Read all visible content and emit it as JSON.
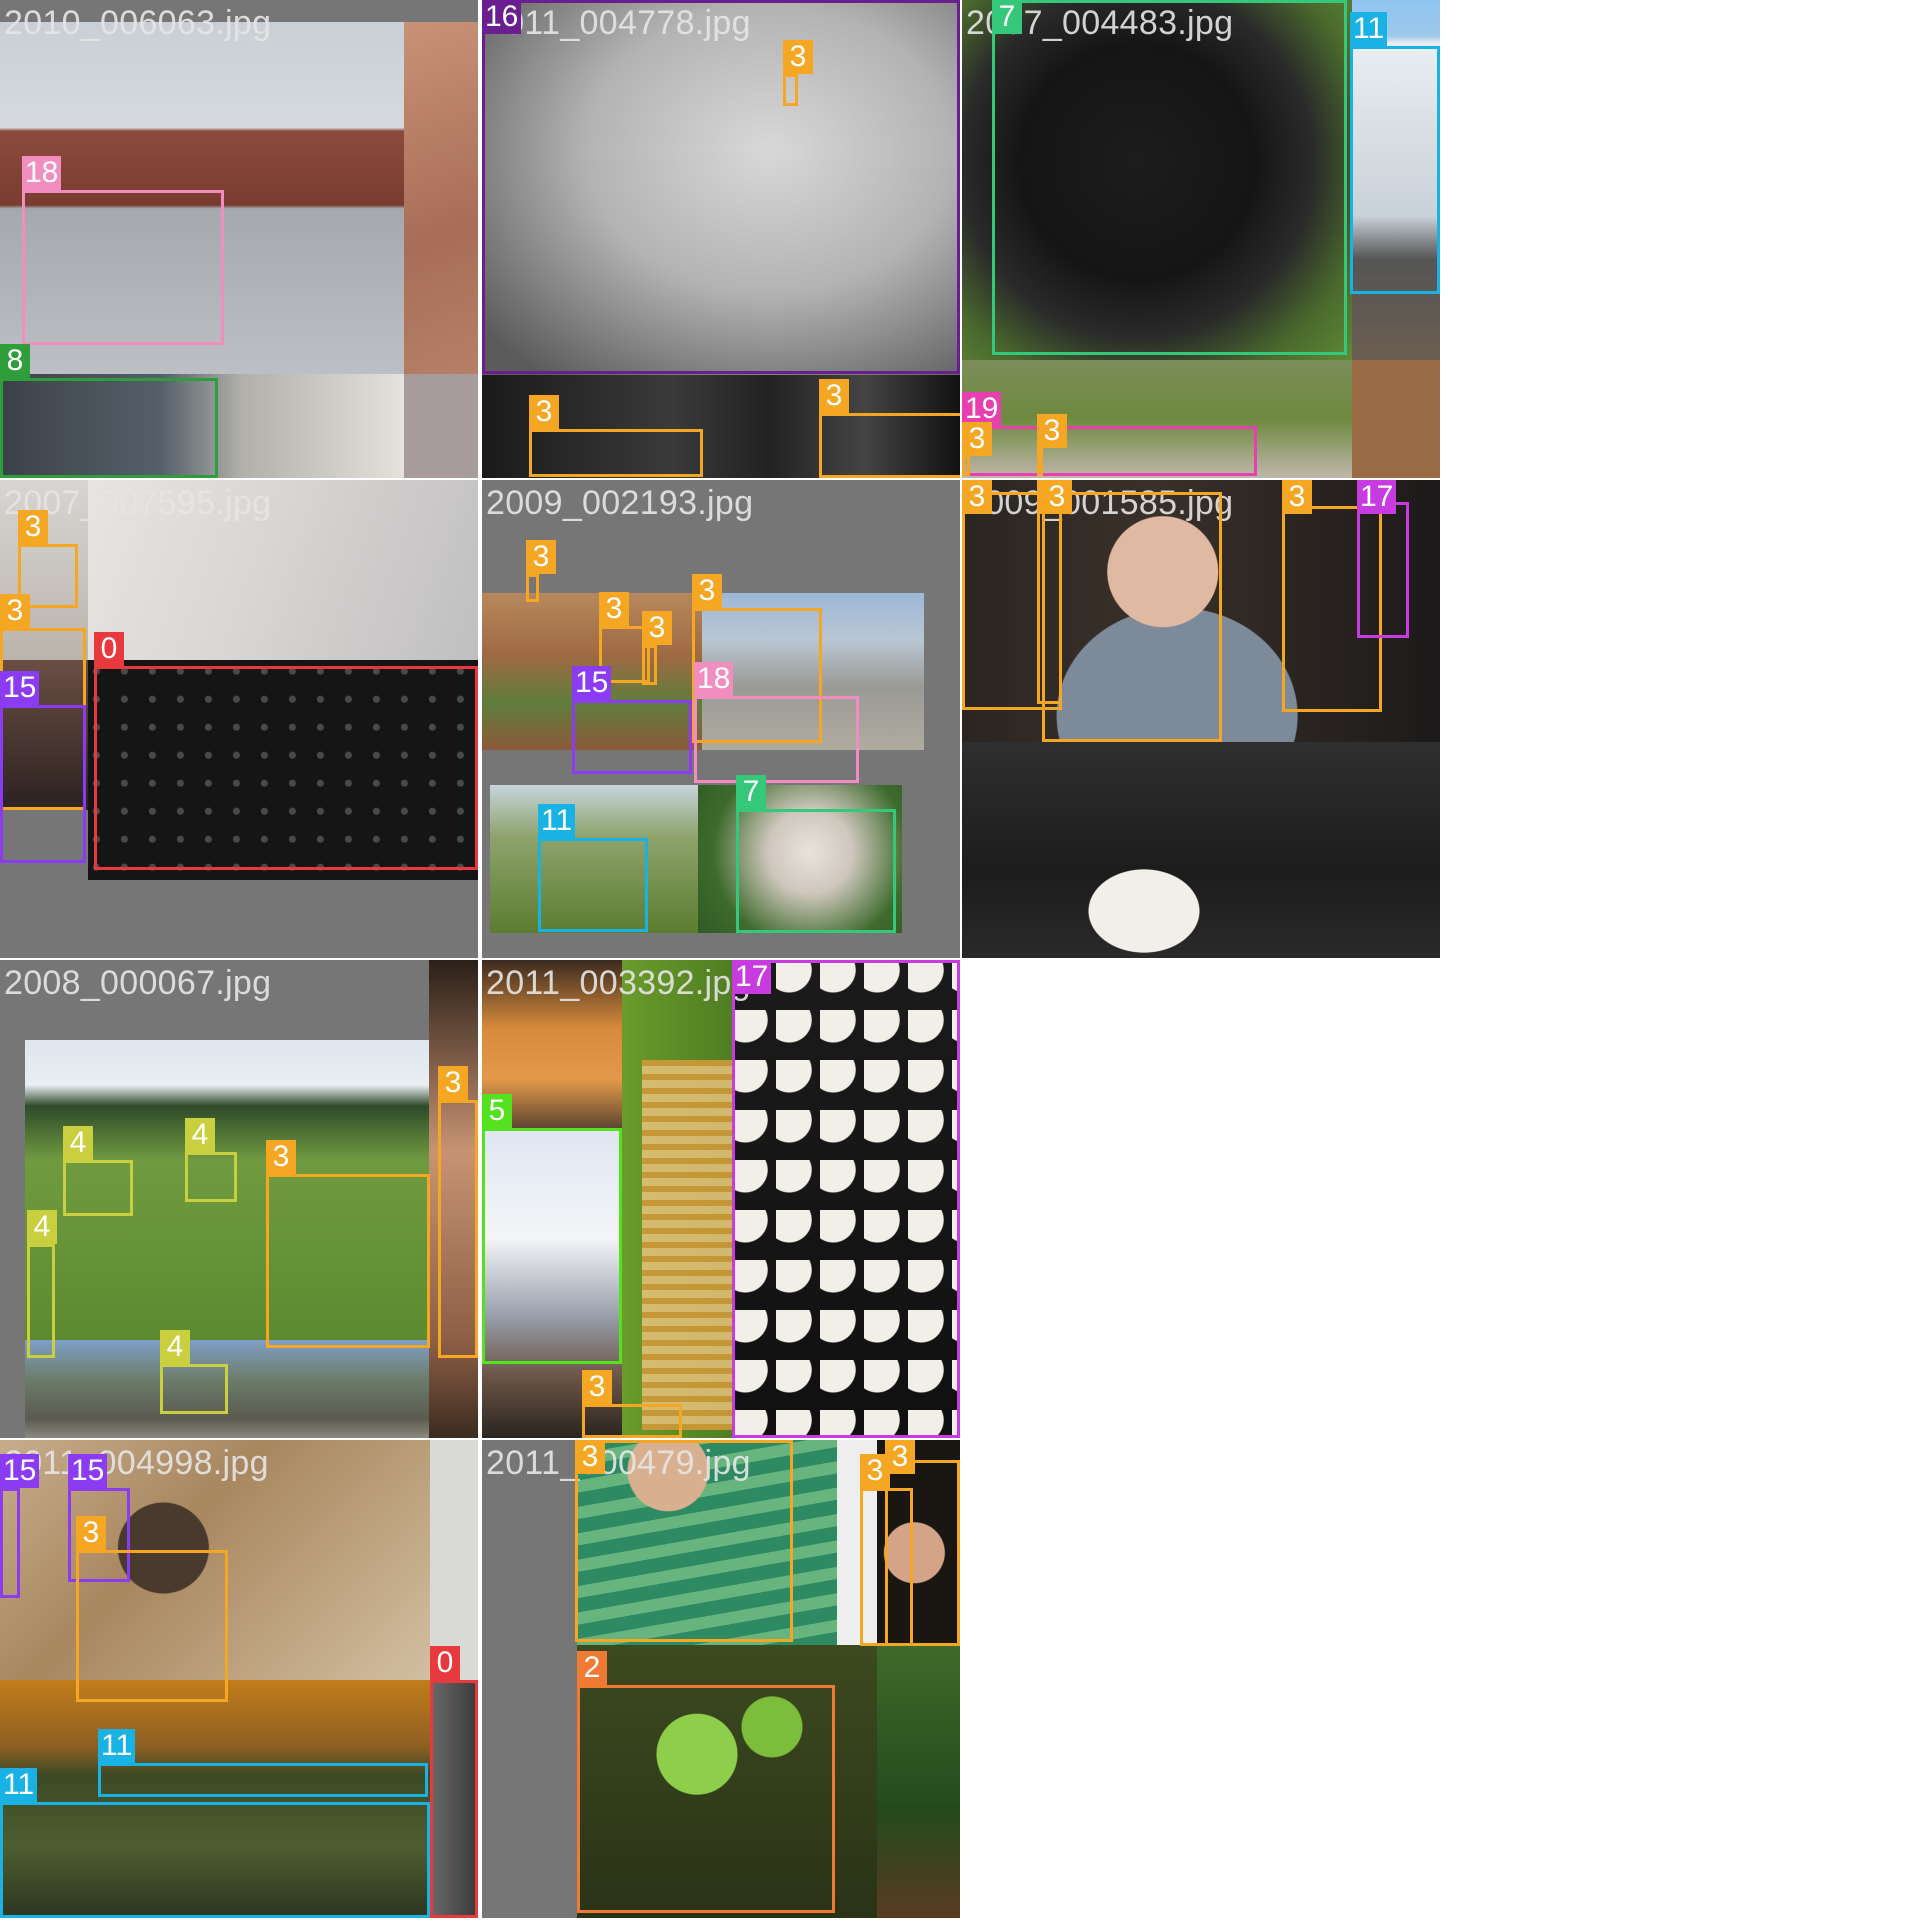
{
  "colors": {
    "0": "#e8393e",
    "2": "#f07a34",
    "3": "#f5a623",
    "4": "#c9cf3e",
    "5": "#55e21e",
    "7": "#35c77a",
    "8": "#2f9d3a",
    "11": "#18b2e4",
    "15": "#8b3bf2",
    "16": "#6a1e8f",
    "17": "#c83be0",
    "18": "#f18dbf",
    "19": "#e83fb0"
  },
  "tiles": [
    {
      "filename": "2010_006063.jpg",
      "boxes": [
        {
          "cls": "18"
        },
        {
          "cls": "8"
        }
      ]
    },
    {
      "filename": "2011_004778.jpg",
      "boxes": [
        {
          "cls": "16"
        },
        {
          "cls": "3"
        },
        {
          "cls": "3"
        },
        {
          "cls": "3"
        }
      ]
    },
    {
      "filename": "2007_004483.jpg",
      "boxes": [
        {
          "cls": "7"
        },
        {
          "cls": "11"
        },
        {
          "cls": "19"
        },
        {
          "cls": "3"
        },
        {
          "cls": "3"
        }
      ]
    },
    {
      "filename": "2007_007595.jpg",
      "boxes": [
        {
          "cls": "3"
        },
        {
          "cls": "3"
        },
        {
          "cls": "0"
        },
        {
          "cls": "15"
        }
      ]
    },
    {
      "filename": "2009_002193.jpg",
      "boxes": [
        {
          "cls": "3"
        },
        {
          "cls": "3"
        },
        {
          "cls": "3"
        },
        {
          "cls": "3"
        },
        {
          "cls": "15"
        },
        {
          "cls": "18"
        },
        {
          "cls": "11"
        },
        {
          "cls": "7"
        }
      ]
    },
    {
      "filename": "2009_001585.jpg",
      "boxes": [
        {
          "cls": "3"
        },
        {
          "cls": "3"
        },
        {
          "cls": "3"
        },
        {
          "cls": "3"
        },
        {
          "cls": "17"
        }
      ]
    },
    {
      "filename": "2008_000067.jpg",
      "boxes": [
        {
          "cls": "3"
        },
        {
          "cls": "3"
        },
        {
          "cls": "4"
        },
        {
          "cls": "4"
        },
        {
          "cls": "4"
        },
        {
          "cls": "4"
        }
      ]
    },
    {
      "filename": "2011_003392.jpg",
      "boxes": [
        {
          "cls": "5"
        },
        {
          "cls": "17"
        },
        {
          "cls": "3"
        }
      ]
    },
    {
      "filename": "2011_004998.jpg",
      "boxes": [
        {
          "cls": "15"
        },
        {
          "cls": "15"
        },
        {
          "cls": "3"
        },
        {
          "cls": "11"
        },
        {
          "cls": "11"
        },
        {
          "cls": "0"
        }
      ]
    },
    {
      "filename": "2011_000479.jpg",
      "boxes": [
        {
          "cls": "3"
        },
        {
          "cls": "3"
        },
        {
          "cls": "3"
        },
        {
          "cls": "2"
        }
      ]
    }
  ]
}
